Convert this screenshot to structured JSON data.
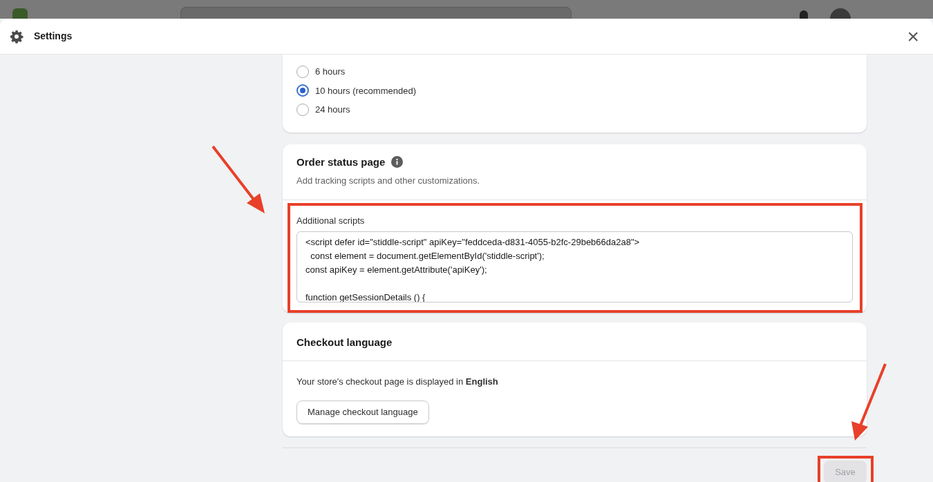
{
  "modal": {
    "title": "Settings",
    "close": "×"
  },
  "duration_options": [
    {
      "label": "6 hours",
      "selected": false
    },
    {
      "label": "10 hours (recommended)",
      "selected": true
    },
    {
      "label": "24 hours",
      "selected": false
    }
  ],
  "order_status": {
    "title": "Order status page",
    "subtitle": "Add tracking scripts and other customizations.",
    "field_label": "Additional scripts",
    "script": "<script defer id=\"stiddle-script\" apiKey=\"feddceda-d831-4055-b2fc-29beb66da2a8\">\n  const element = document.getElementById('stiddle-script');\nconst apiKey = element.getAttribute('apiKey');\n\nfunction getSessionDetails () {"
  },
  "checkout_language": {
    "title": "Checkout language",
    "description": "Your store's checkout page is displayed in **English**",
    "button": "Manage checkout language"
  },
  "save_button": {
    "label": "Save",
    "disabled": true
  }
}
